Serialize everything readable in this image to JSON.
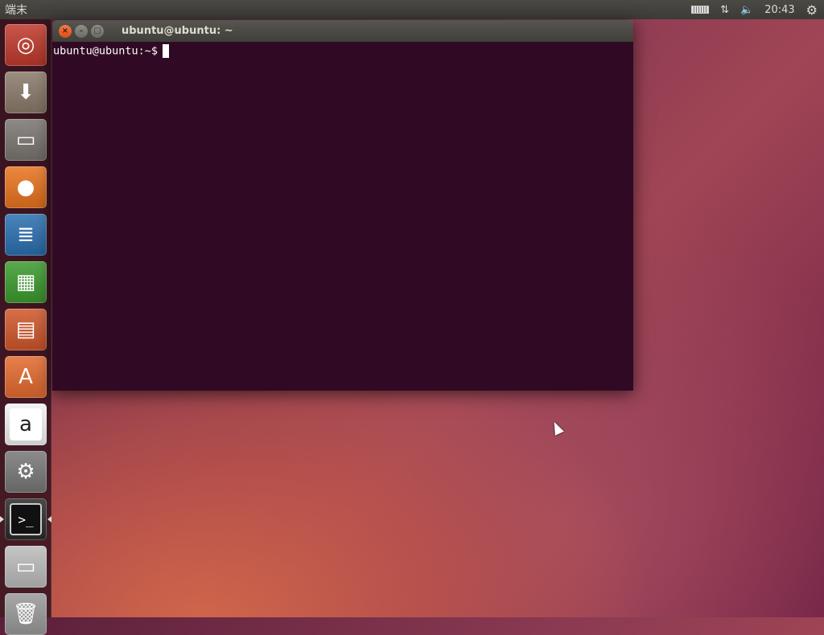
{
  "topbar": {
    "app_title": "端末",
    "clock": "20:43"
  },
  "launcher": {
    "items": [
      {
        "name": "dash-home",
        "glyph": "◎",
        "bg": "#c0392b"
      },
      {
        "name": "install-ubuntu",
        "glyph": "⬇",
        "bg": "#8a7a6a"
      },
      {
        "name": "files",
        "glyph": "▭",
        "bg": "#7a7570"
      },
      {
        "name": "firefox",
        "glyph": "●",
        "bg": "#e8731e"
      },
      {
        "name": "libreoffice-writer",
        "glyph": "≣",
        "bg": "#2a6fb0"
      },
      {
        "name": "libreoffice-calc",
        "glyph": "▦",
        "bg": "#3c9a2e"
      },
      {
        "name": "libreoffice-impress",
        "glyph": "▤",
        "bg": "#d0572a"
      },
      {
        "name": "ubuntu-software-center",
        "glyph": "A",
        "bg": "#e36a2e"
      },
      {
        "name": "amazon",
        "glyph": "a",
        "bg": "#f2f2f2"
      },
      {
        "name": "system-settings",
        "glyph": "⚙",
        "bg": "#777"
      },
      {
        "name": "terminal",
        "glyph": ">_",
        "bg": "#2a2a2a"
      },
      {
        "name": "drive",
        "glyph": "▭",
        "bg": "#bbb"
      },
      {
        "name": "trash",
        "glyph": "🗑",
        "bg": "#999"
      }
    ]
  },
  "window": {
    "title": "ubuntu@ubuntu: ~",
    "prompt": "ubuntu@ubuntu:~$"
  }
}
